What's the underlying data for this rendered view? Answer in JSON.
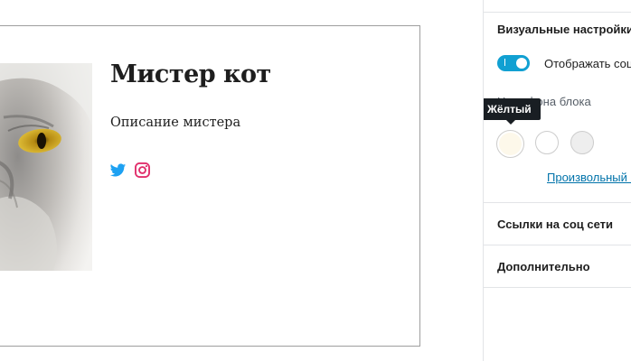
{
  "block": {
    "name": "Мистер кот",
    "description": "Описание мистера",
    "social_icons": [
      "twitter-icon",
      "instagram-icon"
    ]
  },
  "sidebar": {
    "visual_settings_title": "Визуальные настройки",
    "toggle_label": "Отображать соц сети",
    "toggle_checked": true,
    "background_label": "Цвет фона блока",
    "tooltip": "Жёлтый",
    "swatches": [
      {
        "name": "yellow",
        "color": "#fdf8ea"
      },
      {
        "name": "white",
        "color": "#ffffff"
      },
      {
        "name": "gray",
        "color": "#eeeeee"
      }
    ],
    "custom_color_link": "Произвольный цвет",
    "social_links_title": "Ссылки на соц сети",
    "advanced_title": "Дополнительно"
  },
  "colors": {
    "accent": "#11a0d2",
    "twitter": "#1da1f2",
    "instagram": "#e1306c",
    "link": "#0073aa"
  }
}
